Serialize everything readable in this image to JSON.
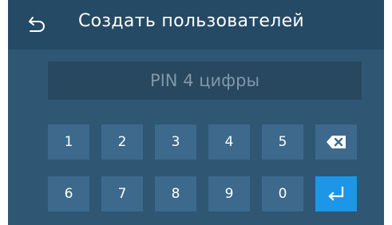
{
  "header": {
    "title": "Создать пользователей",
    "back_icon": "undo-arrow-icon"
  },
  "pin_field": {
    "placeholder": "PIN 4 цифры",
    "value": ""
  },
  "keypad": {
    "row1": [
      "1",
      "2",
      "3",
      "4",
      "5"
    ],
    "row2": [
      "6",
      "7",
      "8",
      "9",
      "0"
    ],
    "backspace_icon": "backspace-icon",
    "enter_icon": "enter-return-icon"
  },
  "colors": {
    "background": "#2f5774",
    "header": "#254a66",
    "field": "#28485f",
    "key": "#3d6a8c",
    "enter_key": "#1d96e8",
    "placeholder_text": "#7f97a8"
  }
}
